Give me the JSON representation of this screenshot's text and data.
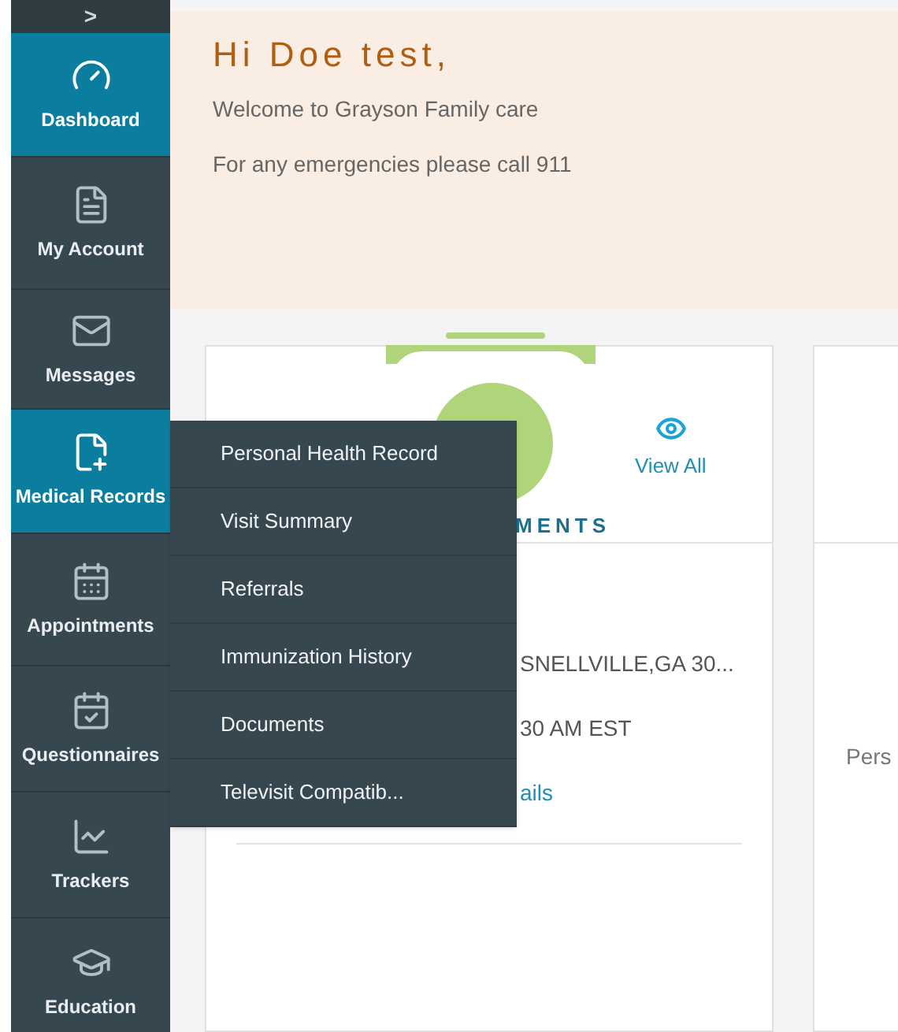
{
  "sidebar": {
    "toggle": ">",
    "items": [
      {
        "label": "Dashboard",
        "selected": true
      },
      {
        "label": "My Account",
        "selected": false
      },
      {
        "label": "Messages",
        "selected": false
      },
      {
        "label": "Medical Records",
        "selected": true,
        "children": [
          {
            "label": "Personal Health Record"
          },
          {
            "label": "Visit Summary"
          },
          {
            "label": "Referrals"
          },
          {
            "label": "Immunization History"
          },
          {
            "label": "Documents"
          },
          {
            "label": "Televisit Compatib..."
          }
        ]
      },
      {
        "label": "Appointments",
        "selected": false
      },
      {
        "label": "Questionnaires",
        "selected": false
      },
      {
        "label": "Trackers",
        "selected": false
      },
      {
        "label": "Education",
        "selected": false
      }
    ]
  },
  "greeting": {
    "title": "Hi Doe test,",
    "lines": [
      "Welcome to Grayson Family care",
      "For any emergencies please call 911"
    ]
  },
  "appointments_card": {
    "view_all": "View All",
    "heading": "MENTS",
    "lines": [
      "SNELLVILLE,GA 30...",
      "30 AM EST"
    ],
    "link": "ails"
  },
  "second_card": {
    "text": "Pers"
  }
}
